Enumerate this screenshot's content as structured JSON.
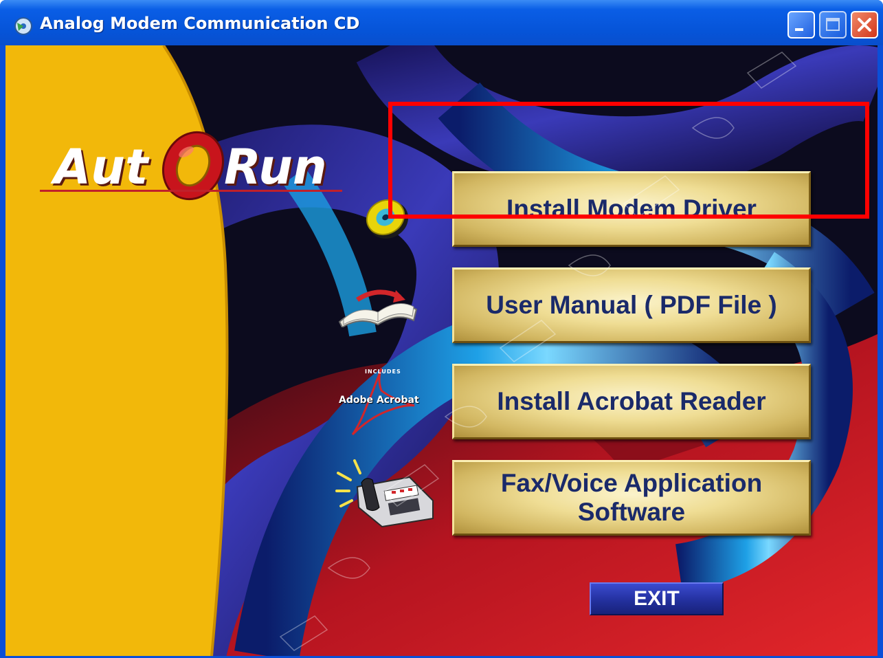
{
  "window": {
    "title": "Analog Modem Communication CD",
    "controls": {
      "minimize": "minimize",
      "maximize": "maximize",
      "close": "close"
    }
  },
  "logo": {
    "left_text": "Aut",
    "right_text": "Run"
  },
  "menu": {
    "items": [
      {
        "label_line1": "Install Modem Driver",
        "label_line2": "",
        "icon": "cd-disc-icon"
      },
      {
        "label_line1": "User Manual ( PDF File )",
        "label_line2": "",
        "icon": "open-book-icon"
      },
      {
        "label_line1": "Install Acrobat Reader",
        "label_line2": "",
        "icon": "adobe-acrobat-icon"
      },
      {
        "label_line1": "Fax/Voice Application",
        "label_line2": "Software",
        "icon": "fax-machine-icon"
      }
    ]
  },
  "exit_label": "EXIT",
  "acrobat_icon_text": "Adobe Acrobat",
  "acrobat_icon_top_text": "INCLUDES",
  "colors": {
    "titlebar": "#0a5ee6",
    "button_text": "#1a2a6a",
    "highlight": "#ff0000",
    "exit_bg": "#23309e",
    "yellow_panel": "#f2b80a"
  }
}
